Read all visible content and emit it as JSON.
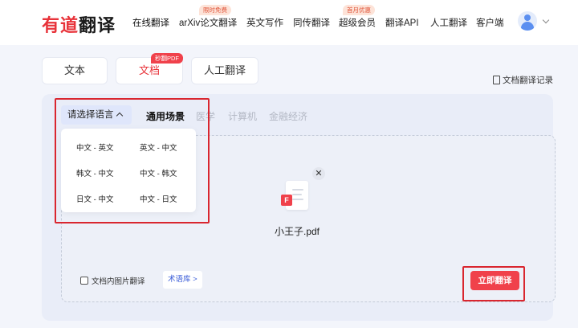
{
  "header": {
    "logo_red": "有道",
    "logo_dark": "翻译",
    "nav": [
      {
        "label": "在线翻译",
        "badge": ""
      },
      {
        "label": "arXiv论文翻译",
        "badge": "限时免费"
      },
      {
        "label": "英文写作",
        "badge": ""
      },
      {
        "label": "同传翻译",
        "badge": ""
      },
      {
        "label": "超级会员",
        "badge": "首月优惠"
      },
      {
        "label": "翻译API",
        "badge": ""
      },
      {
        "label": "人工翻译",
        "badge": ""
      },
      {
        "label": "客户端",
        "badge": ""
      }
    ]
  },
  "mode_tabs": [
    {
      "label": "文本"
    },
    {
      "label": "文档",
      "badge": "秒翻PDF"
    },
    {
      "label": "人工翻译"
    }
  ],
  "history_label": "文档翻译记录",
  "language_selector": {
    "label": "请选择语言",
    "options": [
      "中文 - 英文",
      "英文 - 中文",
      "韩文 - 中文",
      "中文 - 韩文",
      "日文 - 中文",
      "中文 - 日文"
    ]
  },
  "scenes": [
    "通用场景",
    "医学",
    "计算机",
    "金融经济"
  ],
  "file": {
    "name": "小王子.pdf",
    "type_letter": "F",
    "close_symbol": "✕"
  },
  "image_translate_label": "文档内图片翻译",
  "term_library_label": "术语库 >",
  "translate_button": "立即翻译",
  "colors": {
    "accent": "#f0414b",
    "link": "#3d5fd8",
    "highlight_box": "#d9262f"
  }
}
